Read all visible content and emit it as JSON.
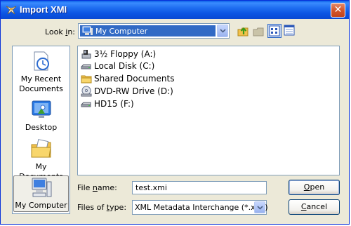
{
  "window": {
    "title": "Import XMI",
    "close_label": "✕"
  },
  "lookin": {
    "label_accel": "i",
    "label_pre": "Look ",
    "label_post": "n:",
    "value": "My Computer"
  },
  "toolbar": {
    "buttons": [
      "up-folder",
      "new-folder",
      "view-list",
      "view-details"
    ]
  },
  "places": [
    {
      "label_line1": "My Recent",
      "label_line2": "Documents",
      "icon": "recent-documents-icon"
    },
    {
      "label_line1": "Desktop",
      "label_line2": "",
      "icon": "desktop-icon"
    },
    {
      "label_line1": "My Documents",
      "label_line2": "",
      "icon": "my-documents-icon"
    },
    {
      "label_line1": "My Computer",
      "label_line2": "",
      "icon": "my-computer-icon",
      "selected": true
    }
  ],
  "files": [
    {
      "label": "3½ Floppy (A:)",
      "icon": "floppy-icon"
    },
    {
      "label": "Local Disk (C:)",
      "icon": "hard-disk-icon"
    },
    {
      "label": "Shared Documents",
      "icon": "folder-icon"
    },
    {
      "label": "DVD-RW Drive (D:)",
      "icon": "dvd-drive-icon"
    },
    {
      "label": "HD15 (F:)",
      "icon": "hard-disk-icon"
    }
  ],
  "filename": {
    "label_pre": "File ",
    "label_accel": "n",
    "label_post": "ame:",
    "value": "test.xmi"
  },
  "filetype": {
    "label_pre": "Files of ",
    "label_accel": "t",
    "label_post": "ype:",
    "value": "XML Metadata Interchange (*.xmi)"
  },
  "buttons": {
    "open": {
      "accel": "O",
      "rest": "pen"
    },
    "cancel": {
      "accel": "C",
      "rest": "ancel"
    }
  }
}
